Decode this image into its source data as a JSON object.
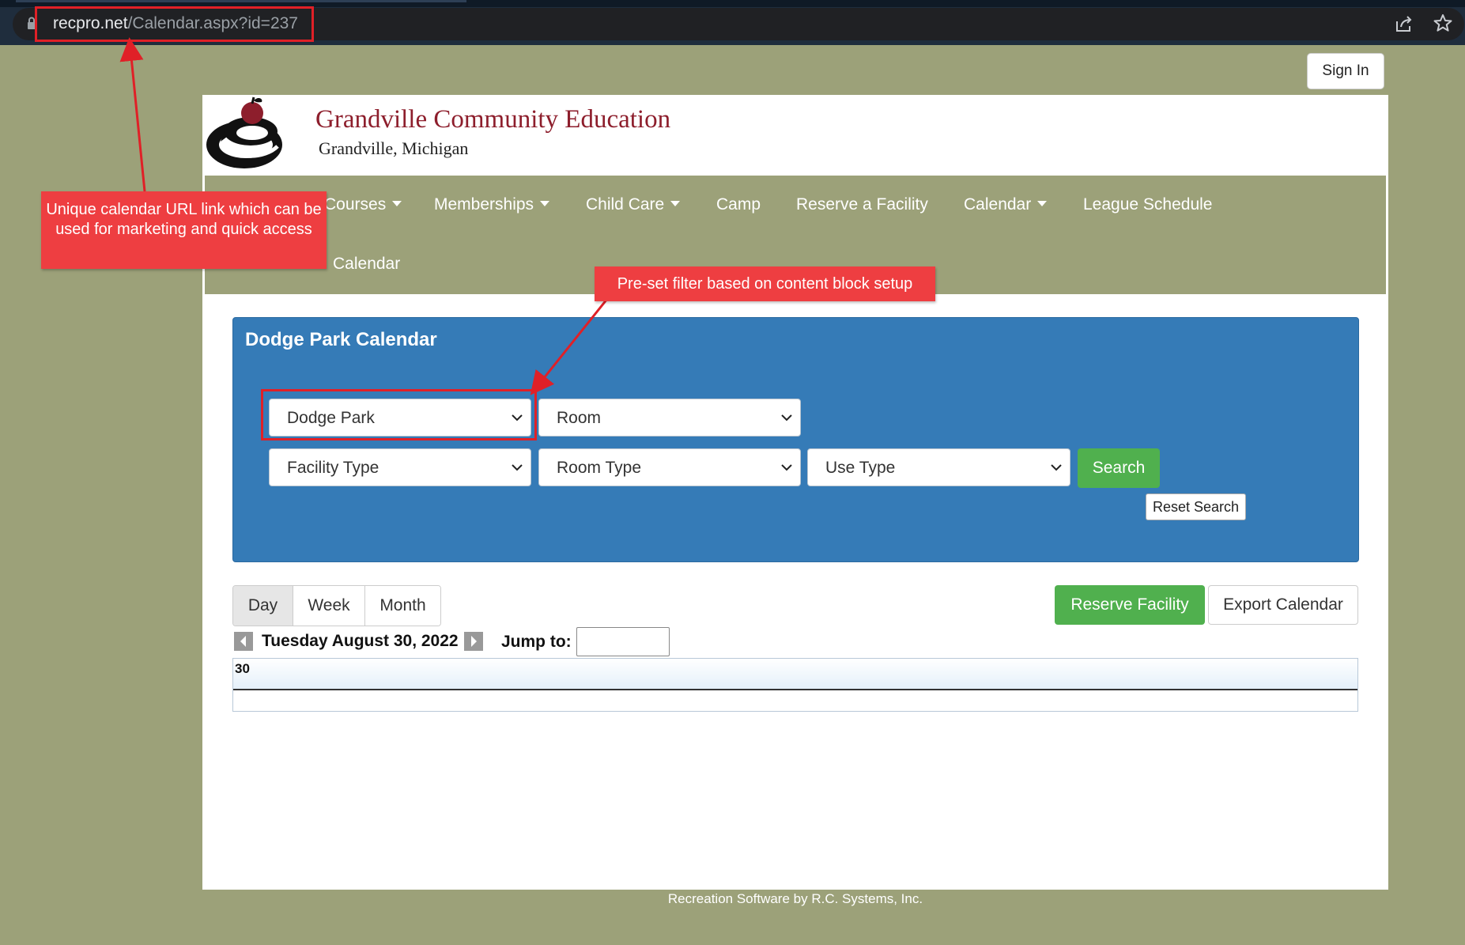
{
  "browser": {
    "url_domain": "recpro.net",
    "url_path": "/Calendar.aspx?id=237"
  },
  "header": {
    "sign_in_label": "Sign In",
    "org_name": "Grandville Community Education",
    "org_location": "Grandville, Michigan"
  },
  "nav": {
    "items": [
      {
        "label": "Courses",
        "dropdown": true
      },
      {
        "label": "Memberships",
        "dropdown": true
      },
      {
        "label": "Child Care",
        "dropdown": true
      },
      {
        "label": "Camp",
        "dropdown": false
      },
      {
        "label": "Reserve a Facility",
        "dropdown": false
      },
      {
        "label": "Calendar",
        "dropdown": true
      },
      {
        "label": "League Schedule",
        "dropdown": false
      }
    ],
    "second_row": [
      "Calendar"
    ]
  },
  "filter_panel": {
    "title": "Dodge Park Calendar",
    "facility_value": "Dodge Park",
    "room_value": "Room",
    "facility_type_value": "Facility Type",
    "room_type_value": "Room Type",
    "use_type_value": "Use Type",
    "search_label": "Search",
    "reset_label": "Reset Search"
  },
  "calendar": {
    "views": [
      "Day",
      "Week",
      "Month"
    ],
    "active_view": "Day",
    "reserve_label": "Reserve Facility",
    "export_label": "Export Calendar",
    "date_label": "Tuesday August 30, 2022",
    "jump_label": "Jump to:",
    "day_number": "30"
  },
  "footer": {
    "text": "Recreation Software by R.C. Systems, Inc."
  },
  "annotations": {
    "url_callout": "Unique calendar URL link which can be used for marketing and quick access",
    "filter_callout": "Pre-set filter based on content block setup"
  },
  "colors": {
    "page_background": "#9ca179",
    "panel_blue": "#357bb7",
    "green_button": "#50b04e",
    "brand_maroon": "#8d1e2c",
    "annotation_red": "#ee3e41"
  }
}
